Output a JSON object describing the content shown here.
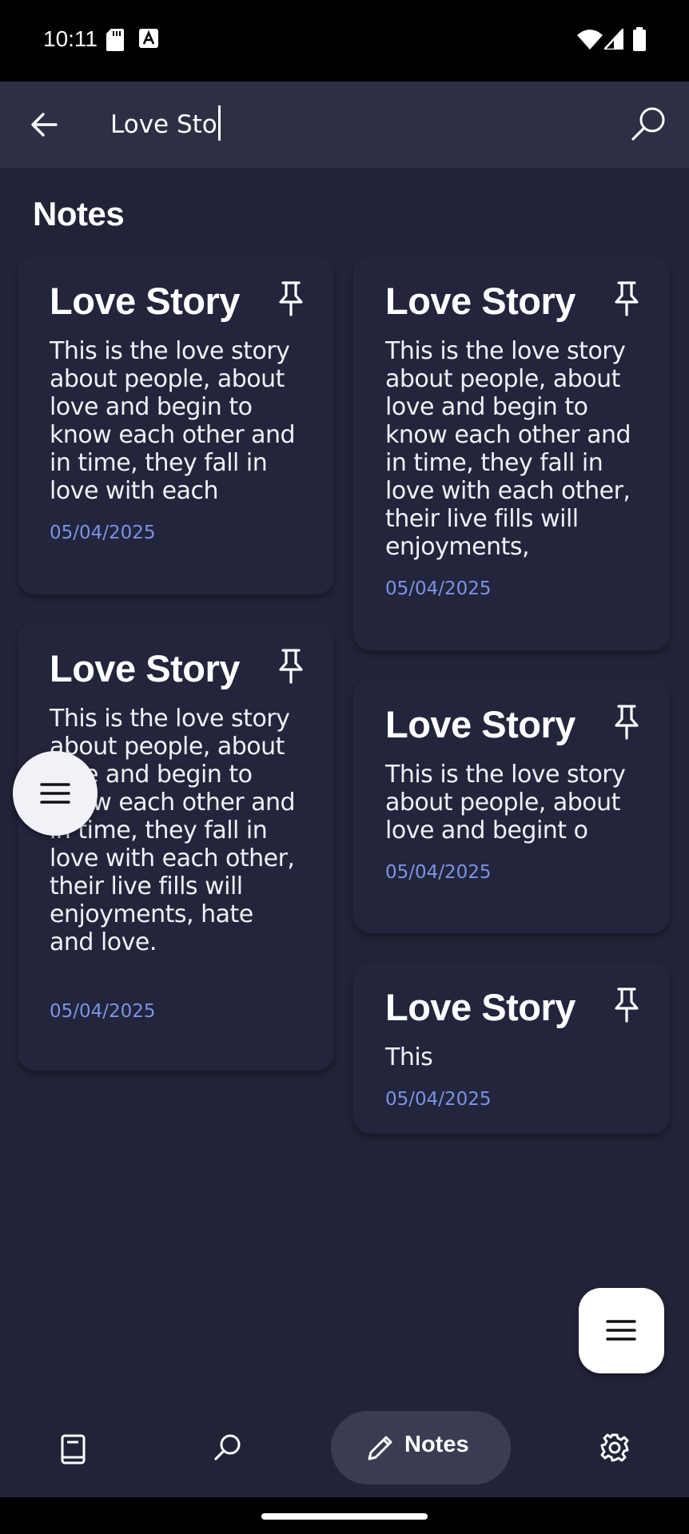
{
  "status_bar": {
    "time": "10:11"
  },
  "search": {
    "query": "Love Sto"
  },
  "section": {
    "title": "Notes"
  },
  "notes_left": [
    {
      "title": "Love Story",
      "body": "This is the love story about people, about love and begin to know each other and in time, they fall in love with each",
      "date": "05/04/2025"
    },
    {
      "title": "Love Story",
      "body": "This is the love story about people, about love and begin to know each other and in time, they fall in love with each other, their live fills will enjoyments, hate and love.",
      "date": "05/04/2025"
    }
  ],
  "notes_right": [
    {
      "title": "Love Story",
      "body": "This is the love story about people, about love and begin to know each other and in time, they fall in love with each other, their live fills will enjoyments,",
      "date": "05/04/2025"
    },
    {
      "title": "Love Story",
      "body": "This is the love story about people, about love and begint o",
      "date": "05/04/2025"
    },
    {
      "title": "Love Story",
      "body": "This",
      "date": "05/04/2025"
    }
  ],
  "bottom_nav": {
    "active_label": "Notes"
  },
  "colors": {
    "background": "#212338",
    "card": "#23253c",
    "top_bar": "#2d3044",
    "date": "#7b93e6",
    "nav_active": "#3a3d52"
  },
  "icons": [
    "back-arrow-icon",
    "search-icon",
    "pin-icon",
    "menu-icon",
    "book-icon",
    "pencil-icon",
    "gear-icon"
  ]
}
